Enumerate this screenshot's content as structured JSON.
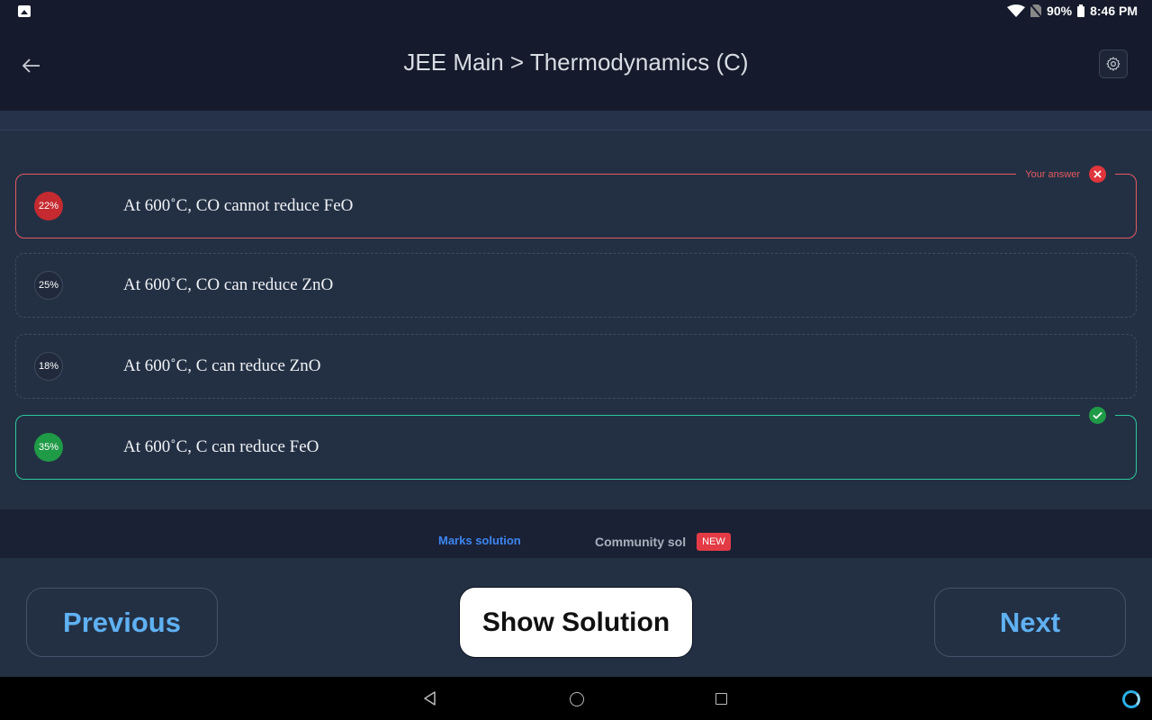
{
  "status_bar": {
    "battery": "90%",
    "time": "8:46 PM"
  },
  "header": {
    "title": "JEE Main > Thermodynamics (C)"
  },
  "options": [
    {
      "percent": "22%",
      "text": "At 600˚C, CO cannot reduce FeO",
      "state": "your-answer-wrong"
    },
    {
      "percent": "25%",
      "text": "At 600˚C, CO can reduce ZnO",
      "state": "neutral"
    },
    {
      "percent": "18%",
      "text": "At 600˚C, C can reduce ZnO",
      "state": "neutral"
    },
    {
      "percent": "35%",
      "text": "At 600˚C, C can reduce FeO",
      "state": "correct"
    }
  ],
  "labels": {
    "your_answer": "Your answer"
  },
  "solution_tabs": {
    "marks": "Marks solution",
    "community": "Community sol",
    "new_badge": "NEW"
  },
  "footer": {
    "previous": "Previous",
    "show_solution": "Show Solution",
    "next": "Next"
  },
  "colors": {
    "wrong": "#e35a62",
    "correct": "#2ec79a",
    "accent": "#3d86f0"
  }
}
